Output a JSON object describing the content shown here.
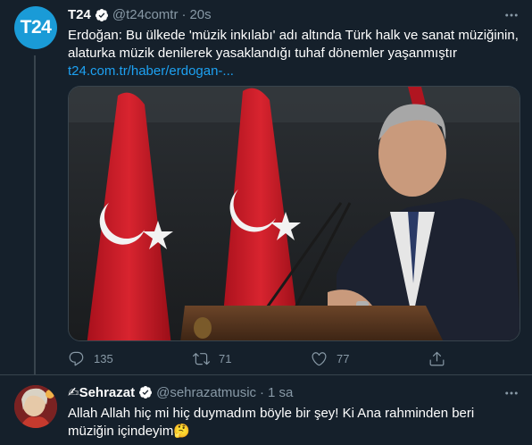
{
  "tweet": {
    "avatar_label": "T24",
    "name": "T24",
    "handle": "@t24comtr",
    "separator": "·",
    "time": "20s",
    "text": "Erdoğan: Bu ülkede 'müzik inkılabı' adı altında Türk halk ve sanat müziğinin, alaturka müzik denilerek yasaklandığı tuhaf dönemler yaşanmıştır",
    "link": "t24.com.tr/haber/erdogan-...",
    "actions": {
      "replies": "135",
      "retweets": "71",
      "likes": "77"
    }
  },
  "reply": {
    "name": "✍Sehrazat",
    "handle": "@sehrazatmusic",
    "separator": "·",
    "time": "1 sa",
    "text": "Allah Allah hiç mi hiç duymadım böyle bir şey! Ki Ana rahminden beri müziğin içindeyim🤔"
  },
  "colors": {
    "background": "#15202b",
    "secondary_text": "#8899a6",
    "link": "#1da1f2",
    "border": "#38444d"
  }
}
